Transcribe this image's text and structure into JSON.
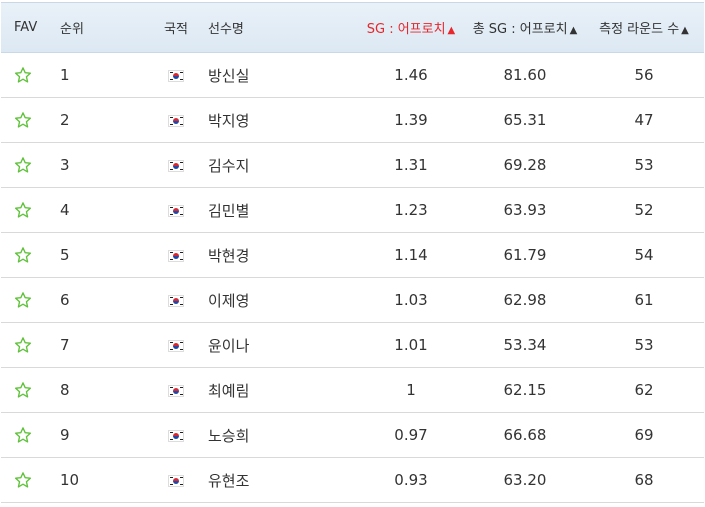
{
  "columns": {
    "fav": "FAV",
    "rank": "순위",
    "nationality": "국적",
    "player": "선수명",
    "sg_approach": "SG : 어프로치",
    "total_sg_approach": "총 SG : 어프로치",
    "rounds": "측정 라운드 수",
    "sort_arrow": "▲"
  },
  "colors": {
    "sorted_header": "#e8262b",
    "star": "#5fc23a",
    "header_bg": "#e4eef7"
  },
  "rows": [
    {
      "rank": "1",
      "flag": "korea-flag-icon",
      "player": "방신실",
      "sg": "1.46",
      "total": "81.60",
      "rounds": "56"
    },
    {
      "rank": "2",
      "flag": "korea-flag-icon",
      "player": "박지영",
      "sg": "1.39",
      "total": "65.31",
      "rounds": "47"
    },
    {
      "rank": "3",
      "flag": "korea-flag-icon",
      "player": "김수지",
      "sg": "1.31",
      "total": "69.28",
      "rounds": "53"
    },
    {
      "rank": "4",
      "flag": "korea-flag-icon",
      "player": "김민별",
      "sg": "1.23",
      "total": "63.93",
      "rounds": "52"
    },
    {
      "rank": "5",
      "flag": "korea-flag-icon",
      "player": "박현경",
      "sg": "1.14",
      "total": "61.79",
      "rounds": "54"
    },
    {
      "rank": "6",
      "flag": "korea-flag-icon",
      "player": "이제영",
      "sg": "1.03",
      "total": "62.98",
      "rounds": "61"
    },
    {
      "rank": "7",
      "flag": "korea-flag-icon",
      "player": "윤이나",
      "sg": "1.01",
      "total": "53.34",
      "rounds": "53"
    },
    {
      "rank": "8",
      "flag": "korea-flag-icon",
      "player": "최예림",
      "sg": "1",
      "total": "62.15",
      "rounds": "62"
    },
    {
      "rank": "9",
      "flag": "korea-flag-icon",
      "player": "노승희",
      "sg": "0.97",
      "total": "66.68",
      "rounds": "69"
    },
    {
      "rank": "10",
      "flag": "korea-flag-icon",
      "player": "유현조",
      "sg": "0.93",
      "total": "63.20",
      "rounds": "68"
    }
  ]
}
